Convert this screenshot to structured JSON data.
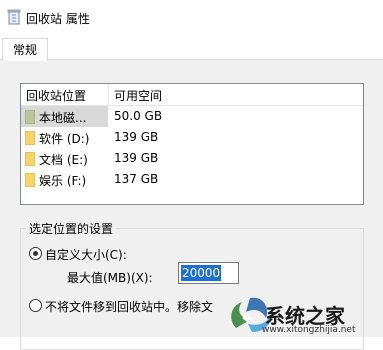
{
  "window": {
    "title": "回收站 属性"
  },
  "tabs": [
    {
      "label": "常规"
    }
  ],
  "list": {
    "columns": [
      "回收站位置",
      "可用空间"
    ],
    "rows": [
      {
        "name": "本地磁...",
        "space": "50.0 GB",
        "icon": "drive-icon",
        "selected": true
      },
      {
        "name": "软件 (D:)",
        "space": "139 GB",
        "icon": "folder-icon"
      },
      {
        "name": "文档 (E:)",
        "space": "139 GB",
        "icon": "folder-icon"
      },
      {
        "name": "娱乐 (F:)",
        "space": "137 GB",
        "icon": "folder-icon"
      }
    ]
  },
  "settings": {
    "group_title": "选定位置的设置",
    "custom_size_label": "自定义大小(C):",
    "max_label": "最大值(MB)(X):",
    "max_value": "20000",
    "no_move_label": "不将文件移到回收站中。移除文"
  },
  "watermark": {
    "text": "系统之家",
    "url": "www.xitongzhijia.net"
  },
  "colors": {
    "selection": "#1e6fd0",
    "folder": "#f6d36b",
    "panel": "#f0f0f0"
  }
}
